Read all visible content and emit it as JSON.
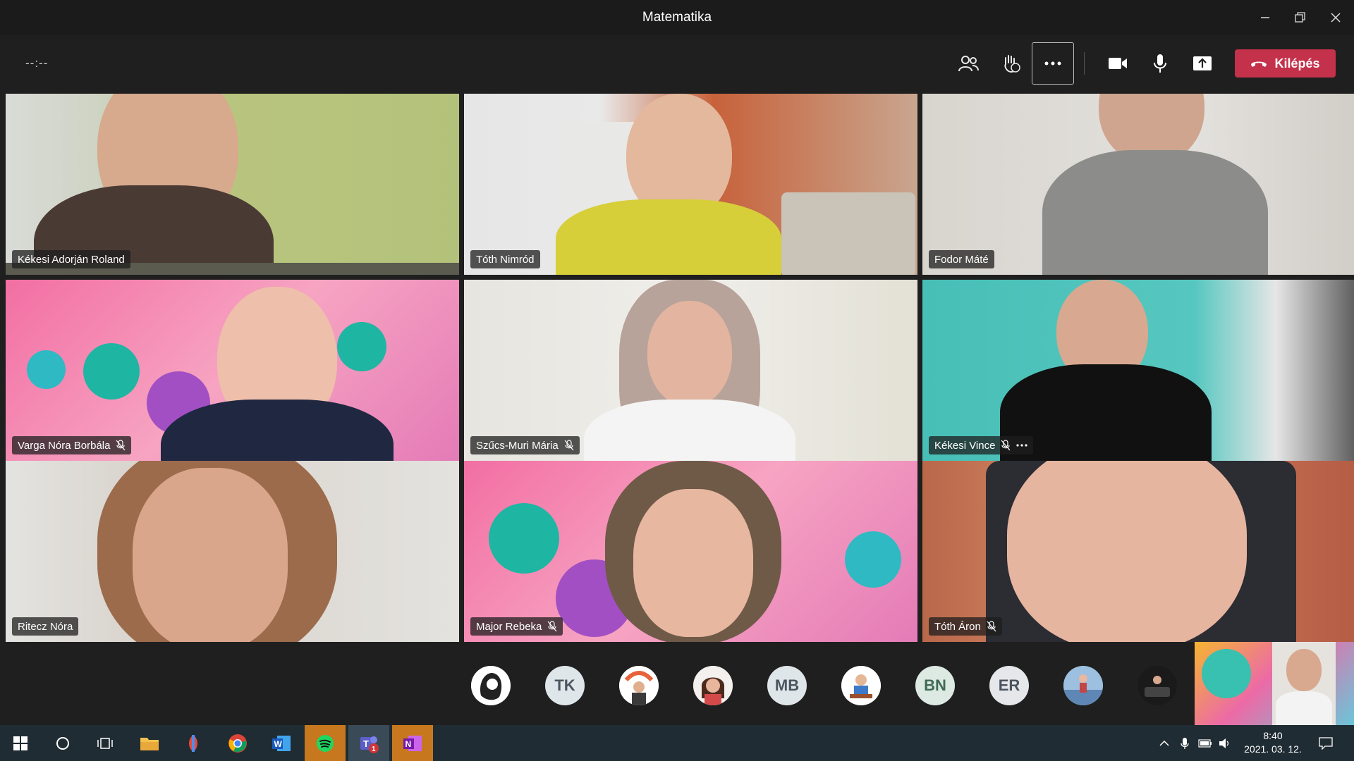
{
  "window": {
    "title": "Matematika"
  },
  "toolbar": {
    "timer": "--:--",
    "leave_label": "Kilépés"
  },
  "participants": [
    {
      "name": "Kékesi Adorján Roland",
      "muted": false,
      "more": false
    },
    {
      "name": "Tóth Nimród",
      "muted": false,
      "more": false
    },
    {
      "name": "Fodor Máté",
      "muted": false,
      "more": false
    },
    {
      "name": "Varga Nóra Borbála",
      "muted": true,
      "more": false
    },
    {
      "name": "Szűcs-Muri Mária",
      "muted": true,
      "more": false
    },
    {
      "name": "Kékesi Vince",
      "muted": true,
      "more": true
    },
    {
      "name": "Ritecz Nóra",
      "muted": false,
      "more": false
    },
    {
      "name": "Major Rebeka",
      "muted": true,
      "more": false
    },
    {
      "name": "Tóth Áron",
      "muted": true,
      "more": false
    }
  ],
  "avatars": [
    "",
    "TK",
    "",
    "",
    "MB",
    "",
    "BN",
    "ER",
    "",
    ""
  ],
  "taskbar": {
    "time": "8:40",
    "date": "2021. 03. 12.",
    "teams_badge": "1"
  },
  "colors": {
    "accent_leave": "#c4314b",
    "taskbar": "#202c33"
  }
}
